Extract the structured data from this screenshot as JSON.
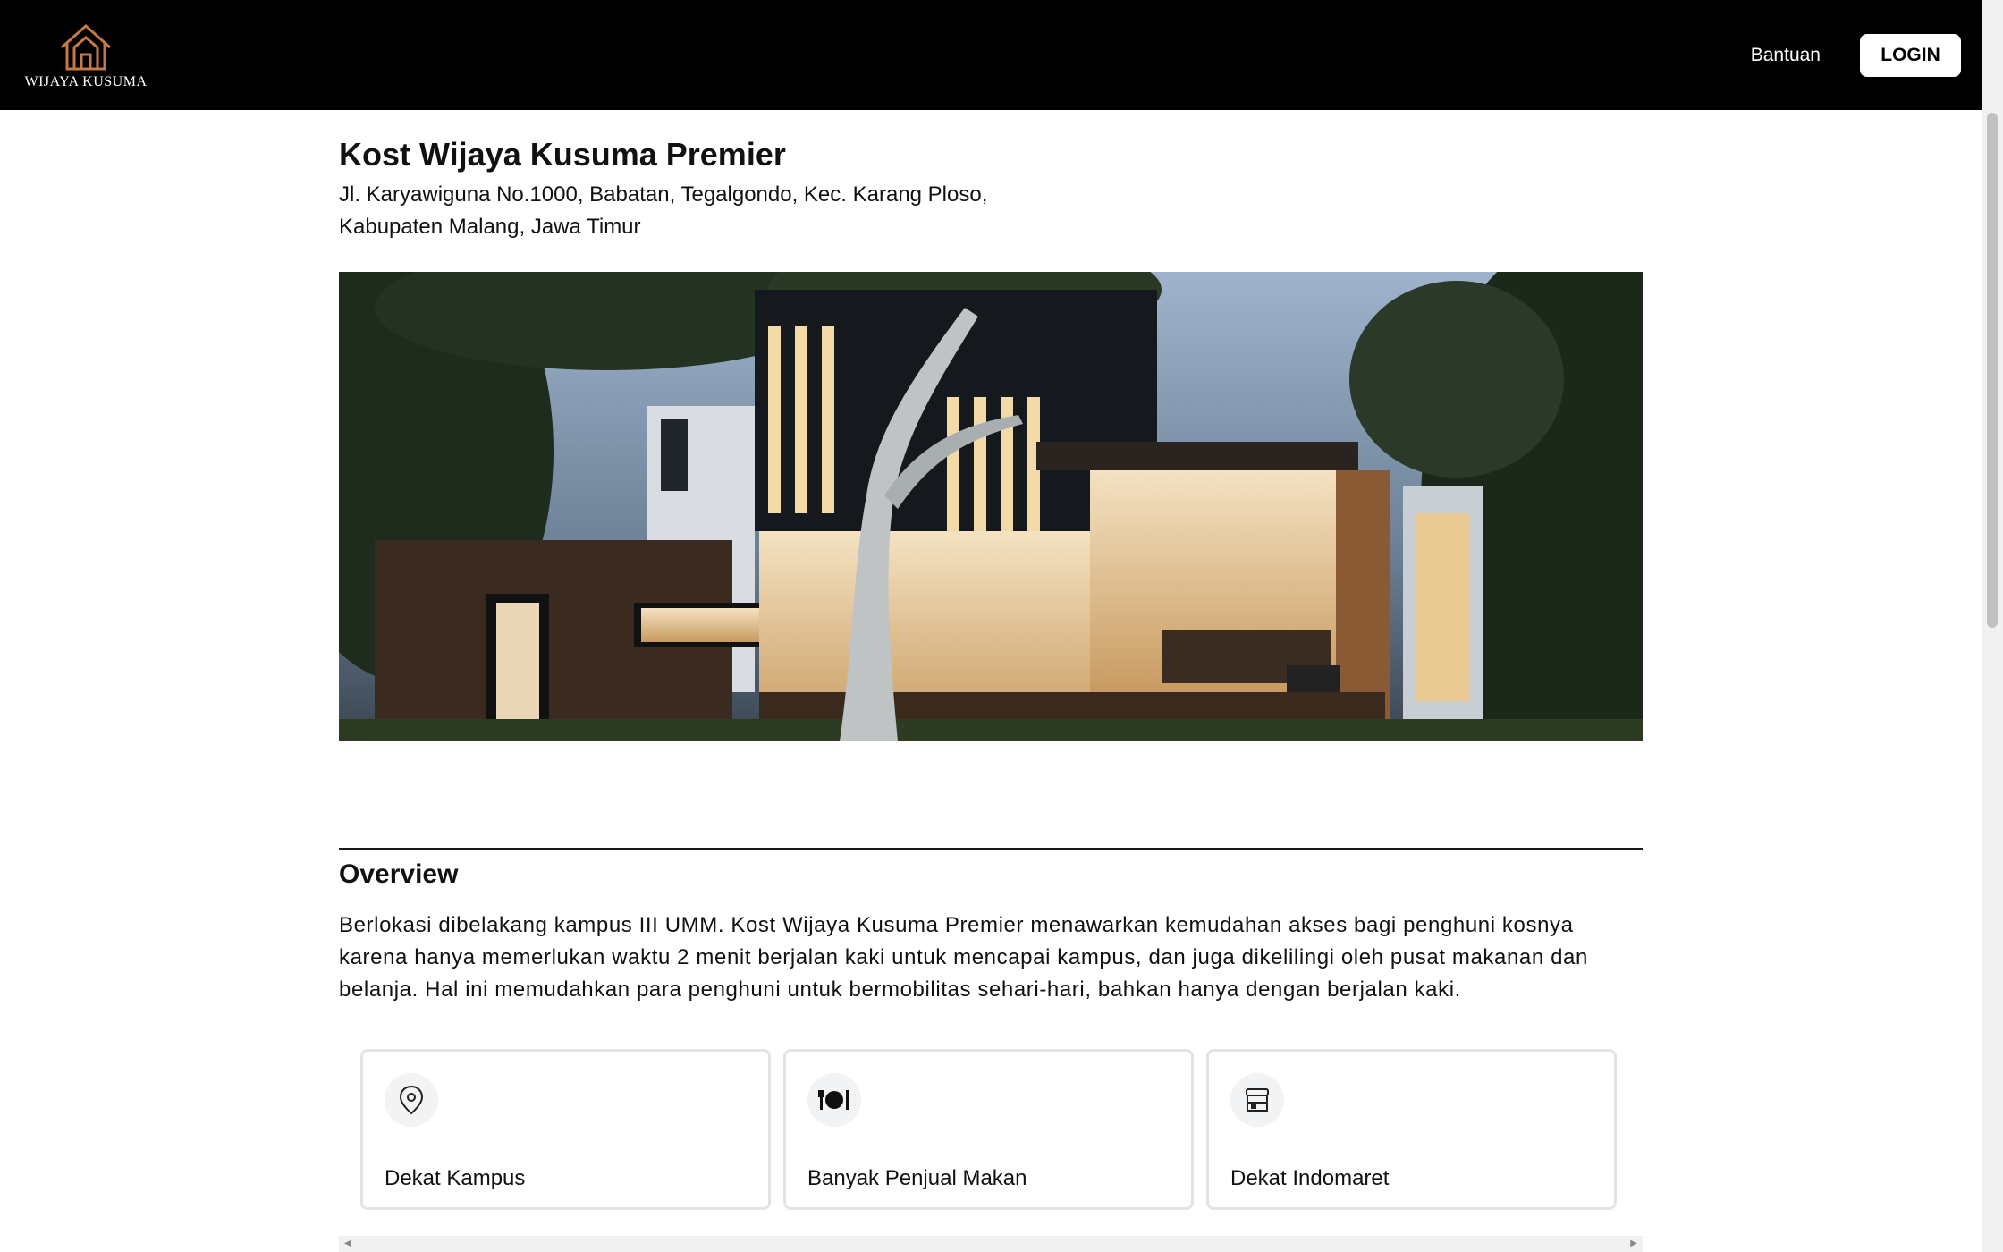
{
  "navbar": {
    "brand_name": "WIJAYA KUSUMA",
    "help_label": "Bantuan",
    "login_label": "LOGIN"
  },
  "property": {
    "title": "Kost Wijaya Kusuma Premier",
    "address_line1": "Jl. Karyawiguna No.1000, Babatan, Tegalgondo, Kec. Karang Ploso,",
    "address_line2": "Kabupaten Malang, Jawa Timur"
  },
  "overview": {
    "heading": "Overview",
    "text": "Berlokasi dibelakang kampus III UMM. Kost Wijaya Kusuma Premier menawarkan kemudahan akses bagi penghuni kosnya karena hanya memerlukan waktu 2 menit berjalan kaki untuk mencapai kampus, dan juga dikelilingi oleh pusat makanan dan belanja. Hal ini memudahkan para penghuni untuk bermobilitas sehari-hari, bahkan hanya dengan berjalan kaki."
  },
  "features": [
    {
      "label": "Dekat Kampus",
      "icon": "map-pin-icon"
    },
    {
      "label": "Banyak Penjual Makan",
      "icon": "dining-icon"
    },
    {
      "label": "Dekat Indomaret",
      "icon": "store-icon"
    }
  ],
  "colors": {
    "navbar_bg": "#000000",
    "logo_accent": "#c47a45"
  }
}
